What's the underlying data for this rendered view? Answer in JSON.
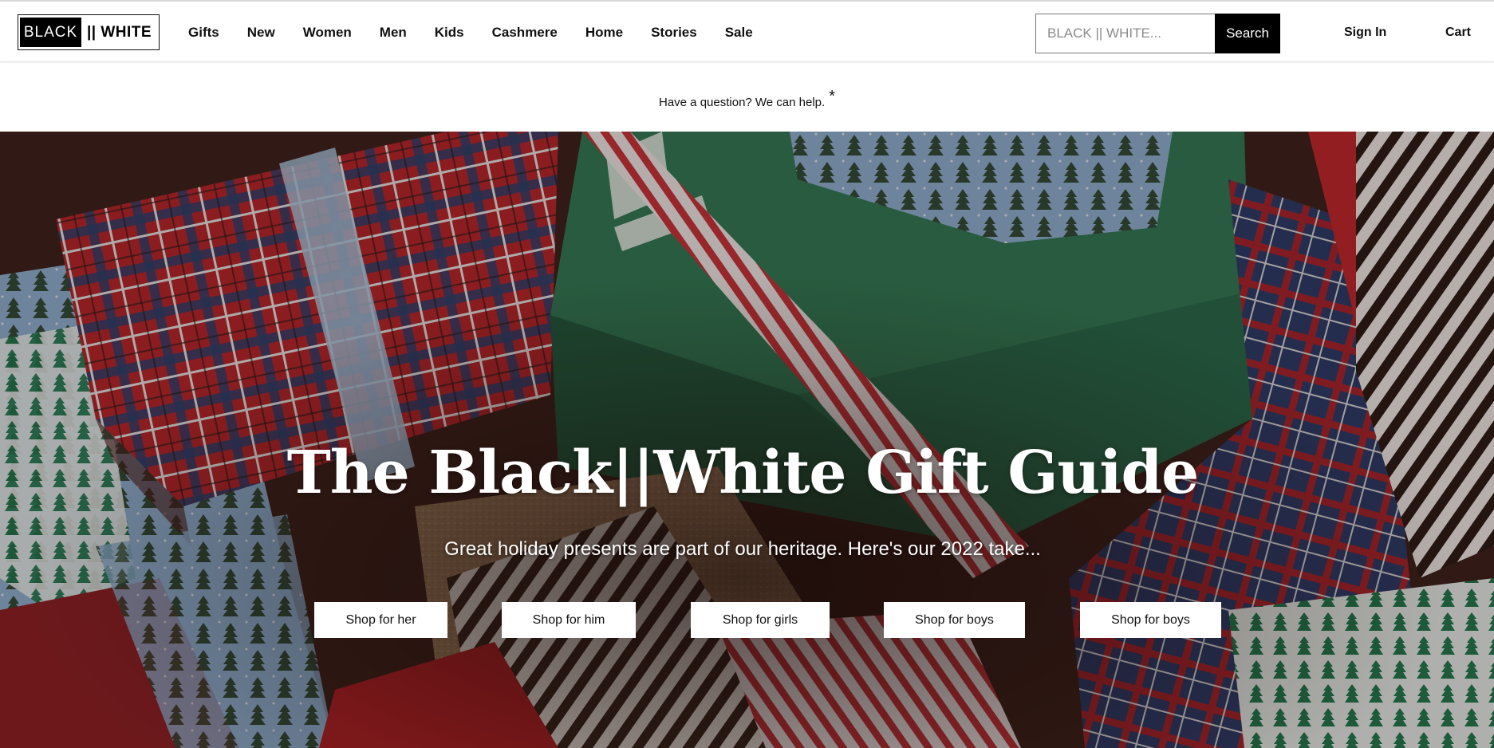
{
  "header": {
    "logo": {
      "left": "BLACK",
      "right": "|| WHITE"
    },
    "nav": [
      "Gifts",
      "New",
      "Women",
      "Men",
      "Kids",
      "Cashmere",
      "Home",
      "Stories",
      "Sale"
    ],
    "search": {
      "placeholder": "BLACK || WHITE...",
      "button_label": "Search"
    },
    "signin_label": "Sign In",
    "cart_label": "Cart"
  },
  "helpbar": {
    "text": "Have a question? We can help.",
    "marker": "*"
  },
  "hero": {
    "title": "The Black||White Gift Guide",
    "subtitle": "Great holiday presents are part of our heritage. Here's our 2022 take...",
    "buttons": [
      "Shop for her",
      "Shop for him",
      "Shop for girls",
      "Shop for boys",
      "Shop for boys"
    ]
  },
  "colors": {
    "black": "#000000",
    "white": "#ffffff",
    "plaid_red": "#c0262c",
    "box_green": "#2e7a55",
    "paper_blue": "#8fb3d6"
  }
}
